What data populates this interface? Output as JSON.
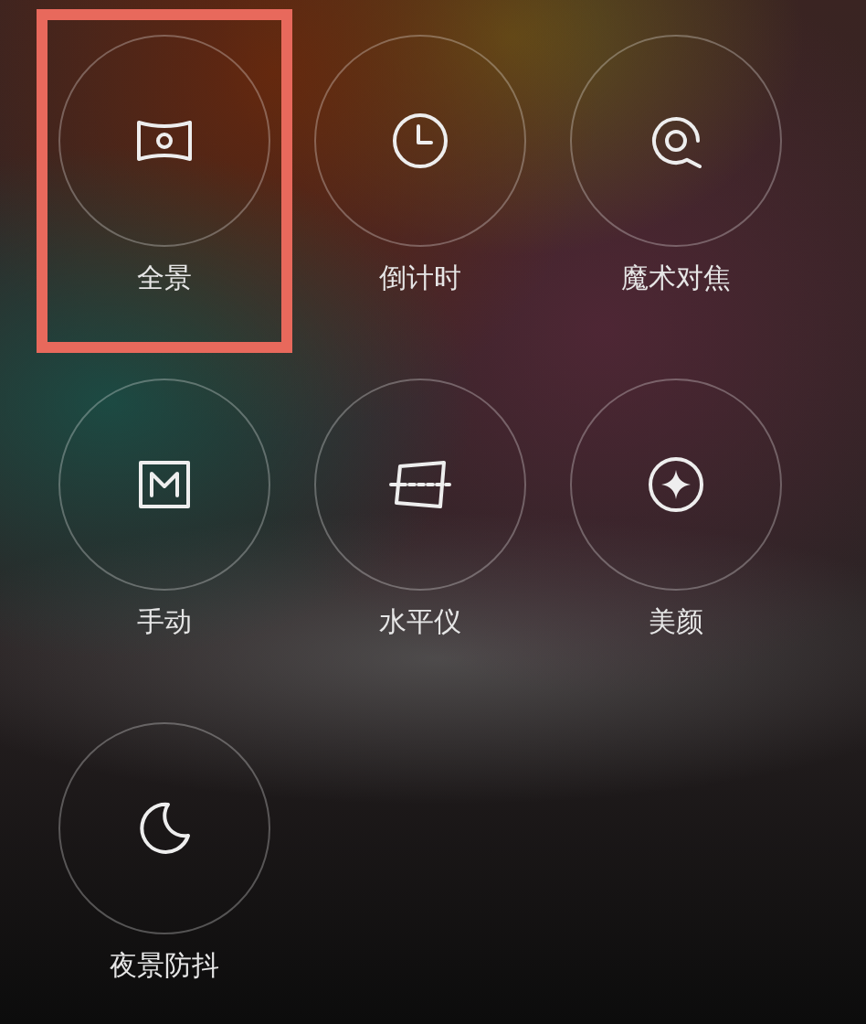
{
  "modes": [
    {
      "kind": "panorama",
      "label": "全景",
      "selected": true
    },
    {
      "kind": "timer",
      "label": "倒计时",
      "selected": false
    },
    {
      "kind": "focus",
      "label": "魔术对焦",
      "selected": false
    },
    {
      "kind": "manual",
      "label": "手动",
      "selected": false
    },
    {
      "kind": "level",
      "label": "水平仪",
      "selected": false
    },
    {
      "kind": "beauty",
      "label": "美颜",
      "selected": false
    },
    {
      "kind": "night",
      "label": "夜景防抖",
      "selected": false
    }
  ]
}
